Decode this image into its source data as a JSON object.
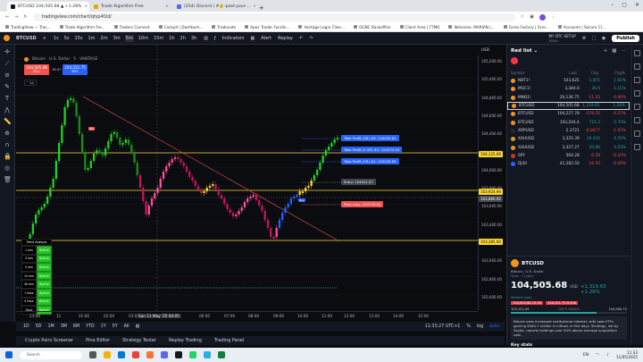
{
  "browser": {
    "tabs": [
      {
        "title": "BTCUSD 104,505.68 ▲ +1.28%",
        "color": "#131722",
        "active": true
      },
      {
        "title": "Trade Algorithm Free",
        "color": "#f0a500",
        "active": false
      },
      {
        "title": "(254) Discord | #💰-post-your-...",
        "color": "#5865f2",
        "active": false
      }
    ],
    "url": "tradingview.com/chart/qfyp4f2d/",
    "bookmarks": [
      "TradingView — Trac...",
      "Trade Algorithm Fre...",
      "Traders Connect",
      "Cockpit | Dashbum...",
      "Tradovate",
      "Apex Trader Fundin...",
      "Vantage Login Clien...",
      "OGNC Backoffice",
      "Client Area | FTMO",
      "Welcome, MARIAN |...",
      "Forex Factory | Fore...",
      "Accounts | Secure Cl..."
    ]
  },
  "toolbar": {
    "symbol": "BTCUSD",
    "timeframes": [
      "1s",
      "5s",
      "15s",
      "1m",
      "2m",
      "3m",
      "5m",
      "10m",
      "15m",
      "1h",
      "2h",
      "3h"
    ],
    "selected": "5m",
    "indicators": "Indicators",
    "alert": "Alert",
    "replay": "Replay",
    "layout": "MY BTC SETUP",
    "layout_sub": "Save",
    "publish": "Publish"
  },
  "chart": {
    "legend": [
      "Bitcoin",
      "U.S. Dollar",
      "5",
      "VANTAGE"
    ],
    "sell_price": "104,505.68",
    "sell_label": "SELL",
    "spread": "16.07",
    "buy_price": "104,521.75",
    "buy_label": "BUY",
    "qty": "12",
    "tags": {
      "tp3": "Take Profit (3R) #3: 104493.81",
      "tp2": "Take Profit (1.5R) #2: 104374.25",
      "tp1": "Take Profit (1R) #1: 104256.69",
      "entry": "Entry: 104051.57",
      "stop": "Stop Loss: 103776.45",
      "sell_marker": "Sell",
      "buy_marker": "Buy"
    },
    "axis_labels": [
      "105,200.00",
      "105,000.00",
      "104,800.00",
      "104,600.00",
      "104,400.00",
      "104,200.00",
      "104,000.00",
      "103,800.00",
      "103,600.00",
      "103,400.00",
      "103,200.00",
      "103,000.00",
      "102,800.00",
      "102,600.00"
    ],
    "axis_tags": {
      "current": "104,125.69",
      "mid": "103,924.94",
      "mid2": "103,860.92",
      "low": "103,385.60"
    },
    "axis_currency": "USD",
    "time_labels": [
      "23:00",
      "11",
      "01:00",
      "02:00",
      "03:00",
      "Sun 11 May '25 04:05",
      "06:00",
      "07:00",
      "08:00",
      "09:00",
      "10:00",
      "11:00",
      "12:00",
      "13:00",
      "14:00",
      "15:00"
    ],
    "indicator_table": {
      "title": "Trend Analysis",
      "rows": [
        [
          "1 min",
          "Bullish"
        ],
        [
          "3 min",
          "Bullish"
        ],
        [
          "5 min",
          "Bullish"
        ],
        [
          "15 min",
          "Bullish"
        ],
        [
          "30 min",
          "Bullish"
        ],
        [
          "1 Hour",
          "Bullish"
        ],
        [
          "4 Hour",
          "Bullish"
        ],
        [
          "Daily",
          "Bullish"
        ]
      ]
    }
  },
  "range": {
    "buttons": [
      "1D",
      "5D",
      "1M",
      "3M",
      "6M",
      "YTD",
      "1Y",
      "5Y",
      "All"
    ],
    "clock": "11:33:27 UTC+1",
    "percent": "%",
    "log": "log",
    "auto": "auto"
  },
  "bottom_tabs": [
    "Crypto Pairs Screener",
    "Pine Editor",
    "Strategy Tester",
    "Replay Trading",
    "Trading Panel"
  ],
  "watchlist": {
    "title": "Red list",
    "columns": [
      "Symbol",
      "Last",
      "Chg",
      "Chg%"
    ],
    "rows": [
      {
        "sym": "NBT1!",
        "last": "103,625",
        "chg": "1,855",
        "pct": "1.82%",
        "dir": "pos",
        "color": "#f7931a"
      },
      {
        "sym": "MGC1!",
        "last": "3,344.0",
        "chg": "36.0",
        "pct": "1.15%",
        "dir": "pos",
        "color": "#f7931a"
      },
      {
        "sym": "MNQ1!",
        "last": "20,136.75",
        "chg": "-11.25",
        "pct": "-0.06%",
        "dir": "neg",
        "color": "#f7931a"
      },
      {
        "sym": "BTCUSD",
        "last": "104,505.68",
        "chg": "1,319.65",
        "pct": "1.28%",
        "dir": "pos",
        "color": "#f7931a",
        "sel": true
      },
      {
        "sym": "BTCUSD",
        "last": "104,227.78",
        "chg": "-279.25",
        "pct": "-0.27%",
        "dir": "neg",
        "color": "#f7931a"
      },
      {
        "sym": "BTCUSD",
        "last": "103,204.4",
        "chg": "716.3",
        "pct": "0.70%",
        "dir": "pos",
        "color": "#f7931a"
      },
      {
        "sym": "XRPUSD",
        "last": "2.3721",
        "chg": "-0.0477",
        "pct": "-1.97%",
        "dir": "neg",
        "color": "#23292f"
      },
      {
        "sym": "XAUUSD",
        "last": "3,325.39",
        "chg": "19.410",
        "pct": "0.59%",
        "dir": "pos",
        "color": "#d4a017"
      },
      {
        "sym": "XAUUSD",
        "last": "3,327.27",
        "chg": "20.86",
        "pct": "0.63%",
        "dir": "pos",
        "color": "#d4a017"
      },
      {
        "sym": "SPY",
        "last": "564.28",
        "chg": "-0.58",
        "pct": "-0.10%",
        "dir": "neg",
        "color": "#c0392b"
      },
      {
        "sym": "DJ30",
        "last": "41,283.50",
        "chg": "-16.50",
        "pct": "-0.04%",
        "dir": "neg",
        "color": "#2962ff"
      }
    ],
    "detail": {
      "symbol": "BTCUSD",
      "name": "Bitcoin / U.S. Dollar",
      "type": "Spot · Crypto",
      "price": "104,505.68",
      "unit": "USD",
      "change": "+1,319.65 +1.28%",
      "status": "Market open",
      "bid": "104,505.68 13.3K",
      "ask": "104,521.75 8.43K",
      "range_low": "103,152.49",
      "range_label": "DAY'S RANGE",
      "range_high": "104,983.72",
      "news": "Bitcoin sees increased institutional interest, with spot ETFs gaining $564.7 million in inflows in five days. Strategy, led by Saylor, reports holdings over 50% above average acquisition cost.",
      "key_stats": "Key stats",
      "volume_label": "Volume",
      "volume": "N/A",
      "avg_label": "Average Volume (30D)"
    }
  },
  "taskbar": {
    "search": "Search",
    "lang": "EN",
    "time": "11:33",
    "date": "11/05/2025"
  }
}
